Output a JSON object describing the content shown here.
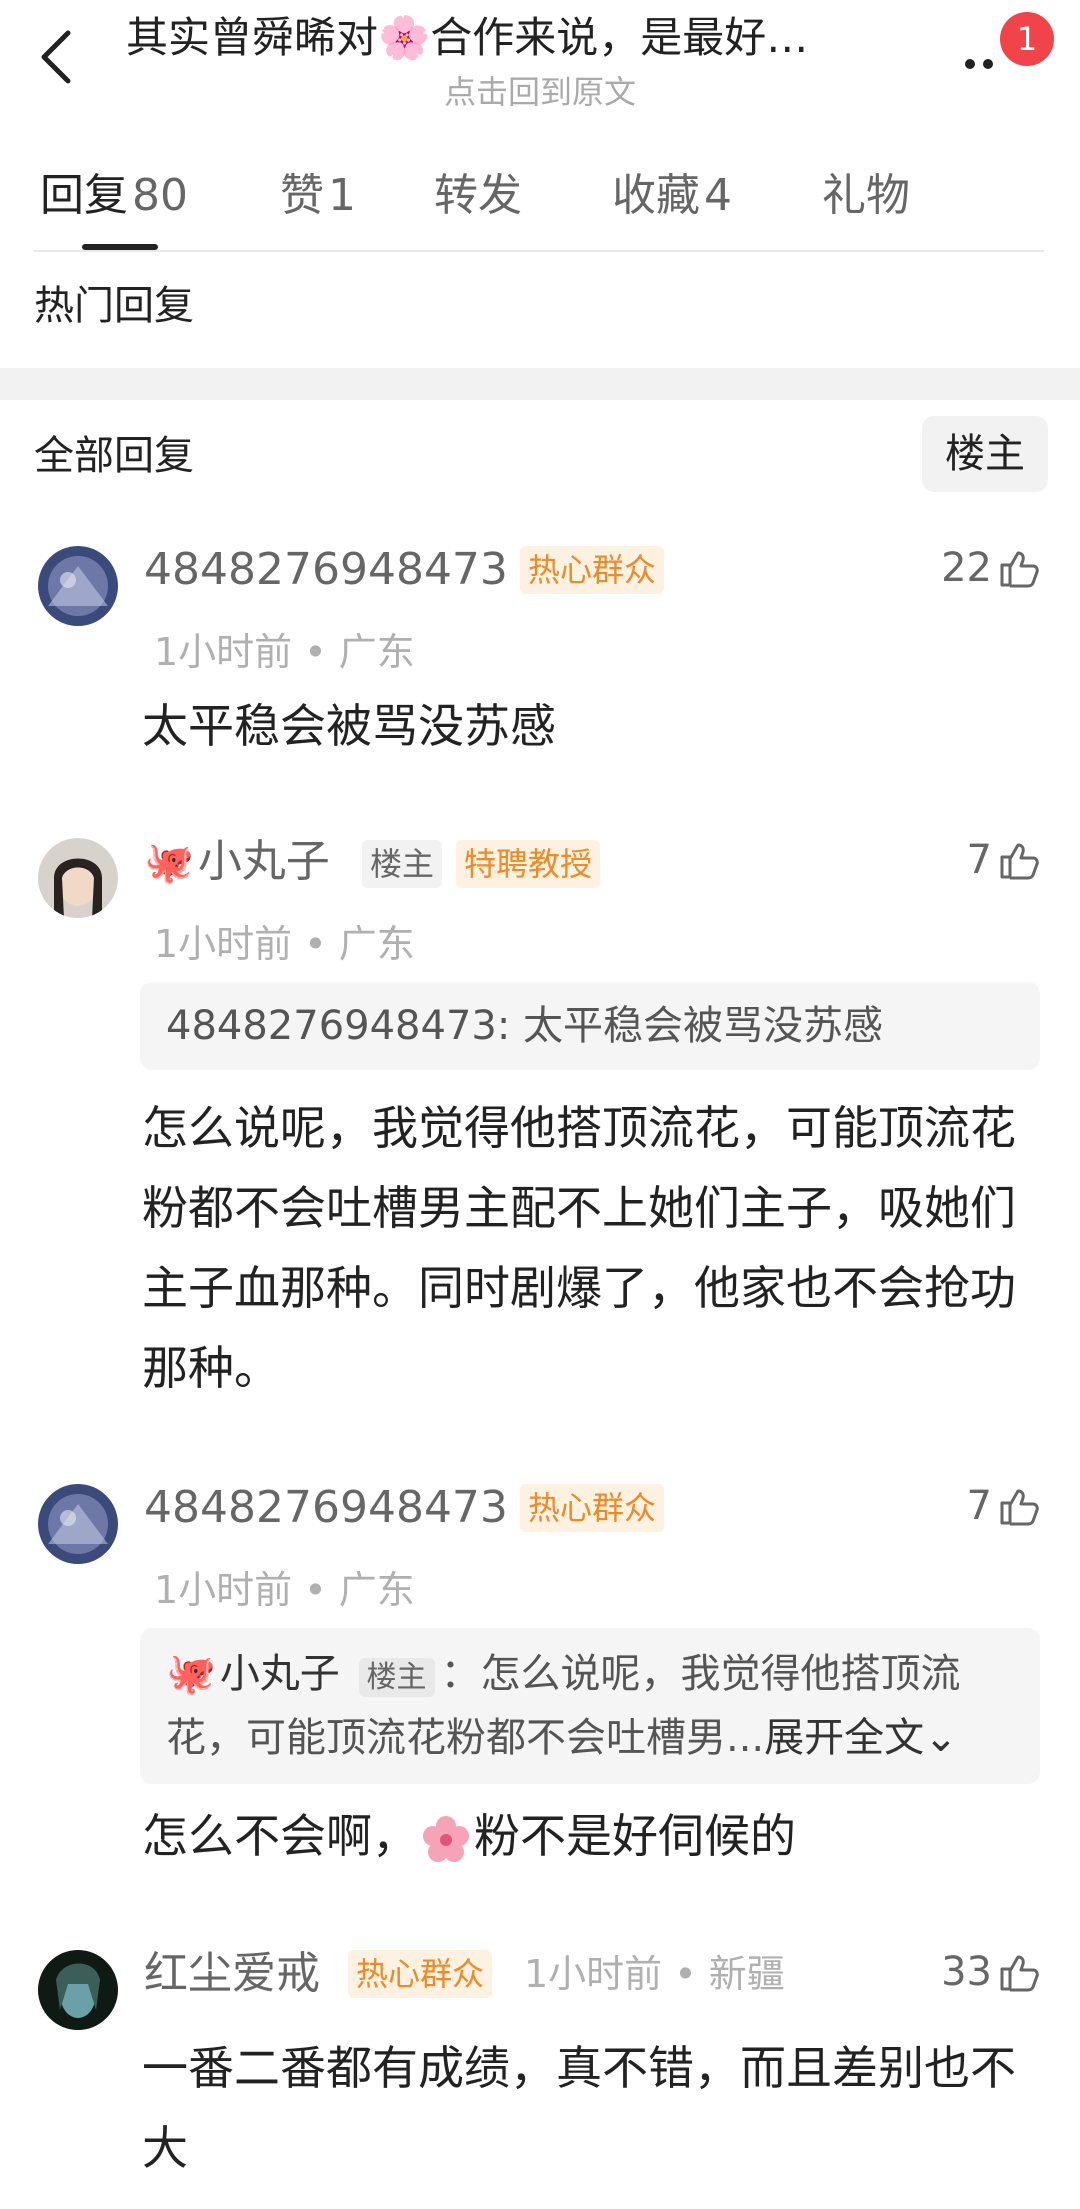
{
  "header": {
    "title": "其实曾舜晞对🌸合作来说，是最好…",
    "subtitle": "点击回到原文",
    "badge": "1"
  },
  "tabs": [
    {
      "label": "回复",
      "count": "80"
    },
    {
      "label": "赞",
      "count": "1"
    },
    {
      "label": "转发",
      "count": ""
    },
    {
      "label": "收藏",
      "count": "4"
    },
    {
      "label": "礼物",
      "count": ""
    }
  ],
  "sections": {
    "hot": "热门回复",
    "all": "全部回复",
    "op_filter": "楼主"
  },
  "comments": [
    {
      "username": "4848276948473",
      "tags": [
        "热心群众"
      ],
      "likes": "22",
      "meta": "1小时前 • 广东",
      "text": "太平稳会被骂没苏感"
    },
    {
      "username": "小丸子",
      "tags": [
        "楼主",
        "特聘教授"
      ],
      "likes": "7",
      "meta": "1小时前 • 广东",
      "quote": "4848276948473: 太平稳会被骂没苏感",
      "text": "怎么说呢，我觉得他搭顶流花，可能顶流花粉都不会吐槽男主配不上她们主子，吸她们主子血那种。同时剧爆了，他家也不会抢功那种。"
    },
    {
      "username": "4848276948473",
      "tags": [
        "热心群众"
      ],
      "likes": "7",
      "meta": "1小时前 • 广东",
      "quote_user": "小丸子",
      "quote_tag": "楼主",
      "quote_text": "：怎么说呢，我觉得他搭顶流花，可能顶流花粉都不会吐槽男...",
      "expand": "展开全文⌄",
      "text_before": "怎么不会啊，",
      "text_after": "粉不是好伺候的"
    },
    {
      "username": "红尘爱戒",
      "tags": [
        "热心群众"
      ],
      "likes": "33",
      "meta": "1小时前 • 新疆",
      "text": "一番二番都有成绩，真不错，而且差别也不大"
    }
  ],
  "colors": {
    "accent_orange": "#ea8c2a",
    "badge_red": "#f0444a",
    "text_primary": "#222222",
    "text_secondary": "#666666",
    "text_meta": "#b0b0b0"
  }
}
